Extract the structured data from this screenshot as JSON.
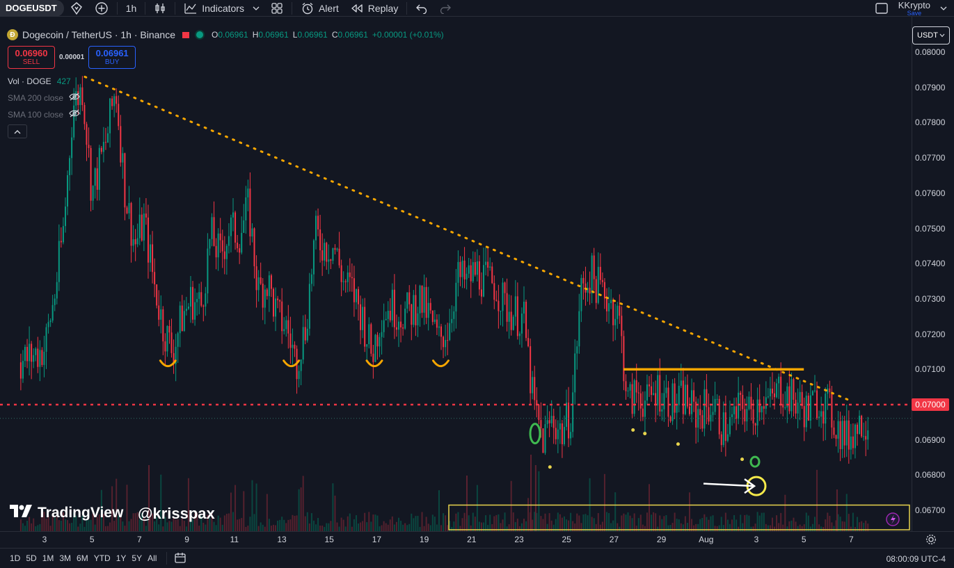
{
  "toolbar": {
    "symbol": "DOGEUSDT",
    "interval": "1h",
    "indicators_label": "Indicators",
    "alert_label": "Alert",
    "replay_label": "Replay",
    "user_name": "KKrypto",
    "save_label": "Save"
  },
  "legend": {
    "pair": "Dogecoin / TetherUS · 1h · Binance",
    "coin_glyph": "Ð",
    "open_label": "O",
    "open": "0.06961",
    "high_label": "H",
    "high": "0.06961",
    "low_label": "L",
    "low": "0.06961",
    "close_label": "C",
    "close": "0.06961",
    "change": "+0.00001 (+0.01%)"
  },
  "trade": {
    "sell_price": "0.06960",
    "sell_label": "SELL",
    "spread": "0.00001",
    "buy_price": "0.06961",
    "buy_label": "BUY"
  },
  "indicators": {
    "vol_label": "Vol · DOGE",
    "vol_value": "427",
    "sma200": "SMA 200 close",
    "sma100": "SMA 100 close"
  },
  "watermark": {
    "brand": "TradingView",
    "handle": "@krisspax"
  },
  "price_axis": {
    "unit": "USDT",
    "ticks": [
      "0.08000",
      "0.07900",
      "0.07800",
      "0.07700",
      "0.07600",
      "0.07500",
      "0.07400",
      "0.07300",
      "0.07200",
      "0.07100",
      "0.07000",
      "0.06900",
      "0.06800",
      "0.06700"
    ],
    "highlight": "0.07000"
  },
  "time_axis": {
    "ticks": [
      "3",
      "5",
      "7",
      "9",
      "11",
      "13",
      "15",
      "17",
      "19",
      "21",
      "23",
      "25",
      "27",
      "29",
      "Aug",
      "3",
      "5",
      "7"
    ]
  },
  "bottombar": {
    "ranges": [
      "1D",
      "5D",
      "1M",
      "3M",
      "6M",
      "YTD",
      "1Y",
      "5Y",
      "All"
    ],
    "clock": "08:00:09 UTC-4"
  },
  "colors": {
    "up": "#089981",
    "down": "#f23645",
    "trendline": "#f7a600",
    "support": "#f7a600",
    "zone": "#e8d44d",
    "bg": "#131722"
  },
  "chart_data": {
    "type": "candlestick",
    "title": "",
    "xlabel": "",
    "ylabel": "",
    "ylim": [
      0.0666,
      0.0807
    ],
    "path_points": [
      [
        3,
        0.0716
      ],
      [
        3.4,
        0.073
      ],
      [
        3.8,
        0.075
      ],
      [
        4.2,
        0.0785
      ],
      [
        4.6,
        0.079
      ],
      [
        5.0,
        0.076
      ],
      [
        5.6,
        0.0775
      ],
      [
        6.0,
        0.079
      ],
      [
        6.4,
        0.076
      ],
      [
        6.8,
        0.0745
      ],
      [
        7.2,
        0.0752
      ],
      [
        7.6,
        0.0735
      ],
      [
        8.0,
        0.0722
      ],
      [
        8.4,
        0.0715
      ],
      [
        8.8,
        0.0725
      ],
      [
        9.2,
        0.073
      ],
      [
        9.6,
        0.0728
      ],
      [
        10.0,
        0.0748
      ],
      [
        10.4,
        0.0742
      ],
      [
        10.8,
        0.075
      ],
      [
        11.2,
        0.0748
      ],
      [
        11.6,
        0.0756
      ],
      [
        12.0,
        0.0732
      ],
      [
        12.4,
        0.0735
      ],
      [
        12.8,
        0.0725
      ],
      [
        13.2,
        0.0722
      ],
      [
        13.6,
        0.0712
      ],
      [
        14.0,
        0.0722
      ],
      [
        14.4,
        0.0748
      ],
      [
        14.8,
        0.0745
      ],
      [
        15.2,
        0.0745
      ],
      [
        15.6,
        0.0735
      ],
      [
        16.0,
        0.0732
      ],
      [
        16.4,
        0.0725
      ],
      [
        16.8,
        0.0714
      ],
      [
        17.2,
        0.0726
      ],
      [
        17.6,
        0.0728
      ],
      [
        18.0,
        0.0726
      ],
      [
        18.4,
        0.0726
      ],
      [
        18.8,
        0.073
      ],
      [
        19.2,
        0.0725
      ],
      [
        19.6,
        0.0718
      ],
      [
        20.0,
        0.0722
      ],
      [
        20.4,
        0.0736
      ],
      [
        20.8,
        0.0735
      ],
      [
        21.2,
        0.0738
      ],
      [
        21.6,
        0.0735
      ],
      [
        22.0,
        0.0734
      ],
      [
        22.4,
        0.0728
      ],
      [
        22.8,
        0.0726
      ],
      [
        23.2,
        0.0724
      ],
      [
        23.6,
        0.07
      ],
      [
        24.0,
        0.069
      ],
      [
        24.4,
        0.0696
      ],
      [
        24.8,
        0.0692
      ],
      [
        25.2,
        0.0698
      ],
      [
        25.6,
        0.0732
      ],
      [
        26.0,
        0.0737
      ],
      [
        26.4,
        0.0733
      ],
      [
        26.8,
        0.073
      ],
      [
        27.2,
        0.0725
      ],
      [
        27.6,
        0.07
      ],
      [
        28.0,
        0.0704
      ],
      [
        28.4,
        0.07
      ],
      [
        28.8,
        0.0705
      ],
      [
        29.2,
        0.0702
      ],
      [
        29.6,
        0.07
      ],
      [
        30.0,
        0.0702
      ],
      [
        30.4,
        0.0697
      ],
      [
        30.8,
        0.0699
      ],
      [
        31.2,
        0.07
      ],
      [
        31.6,
        0.0693
      ],
      [
        32.0,
        0.0695
      ],
      [
        32.4,
        0.07
      ],
      [
        32.8,
        0.0697
      ],
      [
        33.2,
        0.0703
      ],
      [
        33.6,
        0.07
      ],
      [
        34.0,
        0.0705
      ],
      [
        34.4,
        0.0702
      ],
      [
        34.8,
        0.07
      ],
      [
        35.2,
        0.0698
      ],
      [
        35.6,
        0.0702
      ],
      [
        36.0,
        0.0699
      ],
      [
        36.4,
        0.0694
      ],
      [
        36.8,
        0.069
      ],
      [
        37.2,
        0.0694
      ],
      [
        37.6,
        0.0696
      ]
    ],
    "x_range": [
      2,
      38.2
    ],
    "annotations": {
      "trendline": [
        [
          4.7,
          0.0793
        ],
        [
          37.0,
          0.0701
        ]
      ],
      "resistance": {
        "x": [
          27.4,
          35.0
        ],
        "y": 0.071
      },
      "level": 0.07,
      "bottoms_x": [
        8.2,
        13.4,
        16.9,
        19.7
      ],
      "volume_zone": {
        "x": [
          19.8,
          38.0
        ]
      }
    }
  }
}
